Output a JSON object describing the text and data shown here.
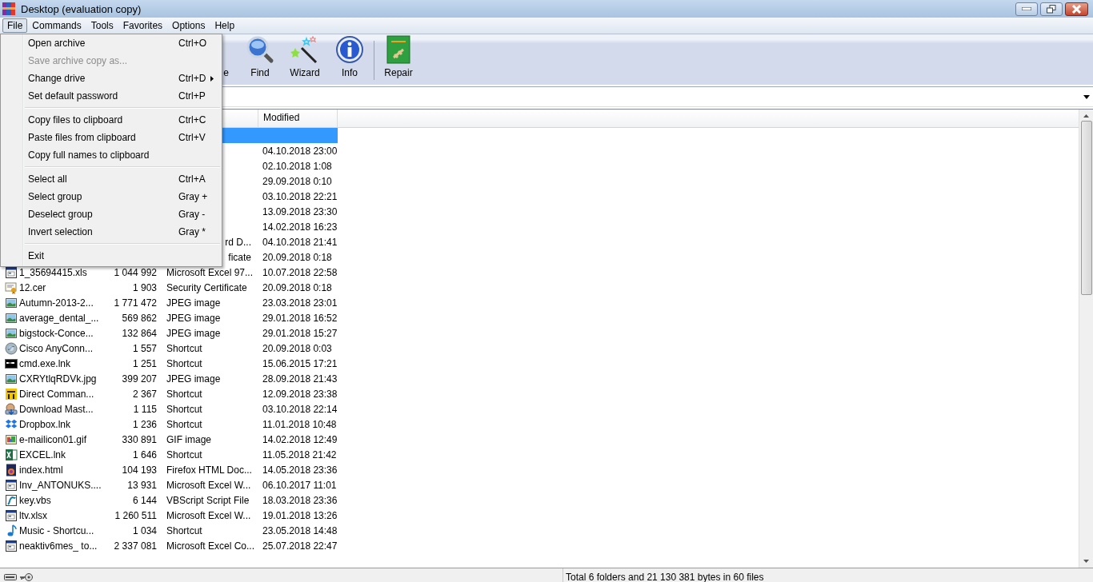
{
  "window": {
    "title": "Desktop (evaluation copy)"
  },
  "menubar": [
    {
      "label": "File",
      "selected": true
    },
    {
      "label": "Commands",
      "selected": false
    },
    {
      "label": "Tools",
      "selected": false
    },
    {
      "label": "Favorites",
      "selected": false
    },
    {
      "label": "Options",
      "selected": false
    },
    {
      "label": "Help",
      "selected": false
    }
  ],
  "file_menu": [
    {
      "kind": "item",
      "label": "Open archive",
      "shortcut": "Ctrl+O",
      "disabled": false,
      "submenu": false
    },
    {
      "kind": "item",
      "label": "Save archive copy as...",
      "disabled": true,
      "submenu": false
    },
    {
      "kind": "item",
      "label": "Change drive",
      "shortcut": "Ctrl+D",
      "disabled": false,
      "submenu": true
    },
    {
      "kind": "item",
      "label": "Set default password",
      "shortcut": "Ctrl+P",
      "disabled": false,
      "submenu": false
    },
    {
      "kind": "separator"
    },
    {
      "kind": "item",
      "label": "Copy files to clipboard",
      "shortcut": "Ctrl+C",
      "disabled": false,
      "submenu": false
    },
    {
      "kind": "item",
      "label": "Paste files from clipboard",
      "shortcut": "Ctrl+V",
      "disabled": false,
      "submenu": false
    },
    {
      "kind": "item",
      "label": "Copy full names to clipboard",
      "disabled": false,
      "submenu": false
    },
    {
      "kind": "separator"
    },
    {
      "kind": "item",
      "label": "Select all",
      "shortcut": "Ctrl+A",
      "disabled": false,
      "submenu": false
    },
    {
      "kind": "item",
      "label": "Select group",
      "shortcut": "Gray +",
      "disabled": false,
      "submenu": false
    },
    {
      "kind": "item",
      "label": "Deselect group",
      "shortcut": "Gray -",
      "disabled": false,
      "submenu": false
    },
    {
      "kind": "item",
      "label": "Invert selection",
      "shortcut": "Gray *",
      "disabled": false,
      "submenu": false
    },
    {
      "kind": "separator"
    },
    {
      "kind": "item",
      "label": "Exit",
      "disabled": false,
      "submenu": false
    }
  ],
  "toolbar": [
    {
      "kind": "partial",
      "label": "e"
    },
    {
      "kind": "find",
      "label": "Find"
    },
    {
      "kind": "wizard",
      "label": "Wizard"
    },
    {
      "kind": "info",
      "label": "Info"
    },
    {
      "kind": "separator"
    },
    {
      "kind": "repair",
      "label": "Repair"
    }
  ],
  "file_list": {
    "columns": [
      "Modified"
    ],
    "rows": [
      {
        "selected": true
      },
      {
        "selected": false,
        "modified": "04.10.2018 23:00"
      },
      {
        "selected": false,
        "modified": "02.10.2018 1:08"
      },
      {
        "selected": false,
        "modified": "29.09.2018 0:10"
      },
      {
        "selected": false,
        "modified": "03.10.2018 22:21"
      },
      {
        "selected": false,
        "modified": "13.09.2018 23:30"
      },
      {
        "selected": false,
        "modified": "14.02.2018 16:23"
      },
      {
        "selected": false,
        "type_partial": "rd D...",
        "modified": "04.10.2018 21:41"
      },
      {
        "selected": false,
        "type_partial": "ficate",
        "modified": "20.09.2018 0:18"
      },
      {
        "selected": false,
        "kind": "sheet",
        "name": "1_35694415.xls",
        "size": "1 044 992",
        "type": "Microsoft Excel 97...",
        "modified": "10.07.2018 22:58"
      },
      {
        "selected": false,
        "kind": "certificate",
        "name": "12.cer",
        "size": "1 903",
        "type": "Security Certificate",
        "modified": "20.09.2018 0:18"
      },
      {
        "selected": false,
        "kind": "image",
        "name": "Autumn-2013-2...",
        "size": "1 771 472",
        "type": "JPEG image",
        "modified": "23.03.2018 23:01"
      },
      {
        "selected": false,
        "kind": "image",
        "name": "average_dental_...",
        "size": "569 862",
        "type": "JPEG image",
        "modified": "29.01.2018 16:52"
      },
      {
        "selected": false,
        "kind": "image",
        "name": "bigstock-Conce...",
        "size": "132 864",
        "type": "JPEG image",
        "modified": "29.01.2018 15:27"
      },
      {
        "selected": false,
        "kind": "globe",
        "name": "Cisco AnyConn...",
        "size": "1 557",
        "type": "Shortcut",
        "modified": "20.09.2018 0:03"
      },
      {
        "selected": false,
        "kind": "console",
        "name": "cmd.exe.lnk",
        "size": "1 251",
        "type": "Shortcut",
        "modified": "15.06.2015 17:21"
      },
      {
        "selected": false,
        "kind": "image",
        "name": "CXRYtlqRDVk.jpg",
        "size": "399 207",
        "type": "JPEG image",
        "modified": "28.09.2018 21:43"
      },
      {
        "selected": false,
        "kind": "panel",
        "name": "Direct Comman...",
        "size": "2 367",
        "type": "Shortcut",
        "modified": "12.09.2018 23:38"
      },
      {
        "selected": false,
        "kind": "download",
        "name": "Download Mast...",
        "size": "1 115",
        "type": "Shortcut",
        "modified": "03.10.2018 22:14"
      },
      {
        "selected": false,
        "kind": "box",
        "name": "Dropbox.lnk",
        "size": "1 236",
        "type": "Shortcut",
        "modified": "11.01.2018 10:48"
      },
      {
        "selected": false,
        "kind": "gif",
        "name": "e-mailicon01.gif",
        "size": "330 891",
        "type": "GIF image",
        "modified": "14.02.2018 12:49"
      },
      {
        "selected": false,
        "kind": "excel",
        "name": "EXCEL.lnk",
        "size": "1 646",
        "type": "Shortcut",
        "modified": "11.05.2018 21:42"
      },
      {
        "selected": false,
        "kind": "browser",
        "name": "index.html",
        "size": "104 193",
        "type": "Firefox HTML Doc...",
        "modified": "14.05.2018 23:36"
      },
      {
        "selected": false,
        "kind": "sheet",
        "name": "Inv_ANTONUKS....",
        "size": "13 931",
        "type": "Microsoft Excel W...",
        "modified": "06.10.2017 11:01"
      },
      {
        "selected": false,
        "kind": "script",
        "name": "key.vbs",
        "size": "6 144",
        "type": "VBScript Script File",
        "modified": "18.03.2018 23:36"
      },
      {
        "selected": false,
        "kind": "sheet",
        "name": "ltv.xlsx",
        "size": "1 260 511",
        "type": "Microsoft Excel W...",
        "modified": "19.01.2018 13:26"
      },
      {
        "selected": false,
        "kind": "music",
        "name": "Music - Shortcu...",
        "size": "1 034",
        "type": "Shortcut",
        "modified": "23.05.2018 14:48"
      },
      {
        "selected": false,
        "kind": "sheet",
        "name": "neaktiv6mes_ to...",
        "size": "2 337 081",
        "type": "Microsoft Excel Co...",
        "modified": "25.07.2018 22:47"
      }
    ]
  },
  "status_bar": {
    "text": "Total 6 folders and 21 130 381 bytes in 60 files"
  }
}
